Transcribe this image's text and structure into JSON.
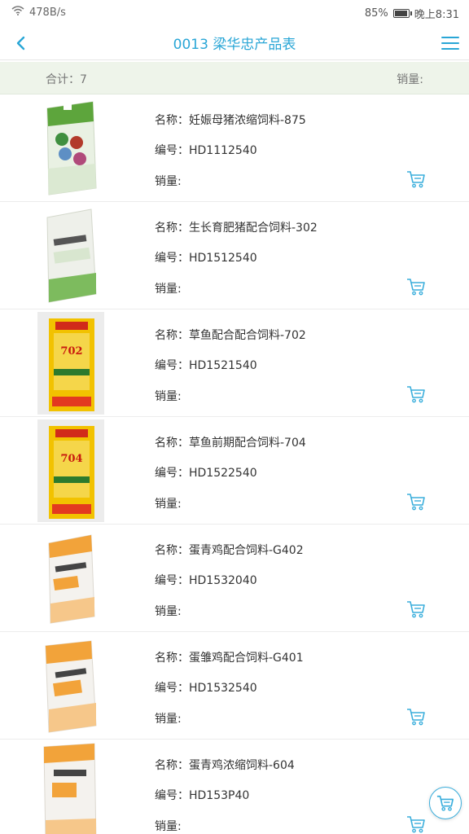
{
  "status_bar": {
    "network_speed": "478B/s",
    "battery": "85%",
    "time": "晚上8:31",
    "battery_level": 0.85
  },
  "header": {
    "title": "0013 梁华忠产品表",
    "back_icon": "chevron-left-icon",
    "menu_icon": "hamburger-menu-icon"
  },
  "summary": {
    "total": "合计：7",
    "sales_label": "销量:"
  },
  "labels": {
    "name": "名称：",
    "code": "编号：",
    "sales": "销量:"
  },
  "accent_color": "#29a6d6",
  "products": [
    {
      "name": "妊娠母猪浓缩饲料-875",
      "code": "HD1112540",
      "bag": "green"
    },
    {
      "name": "生长育肥猪配合饲料-302",
      "code": "HD1512540",
      "bag": "white-green"
    },
    {
      "name": "草鱼配合配合饲料-702",
      "code": "HD1521540",
      "bag": "yellow-red",
      "bag_text": "702"
    },
    {
      "name": "草鱼前期配合饲料-704",
      "code": "HD1522540",
      "bag": "yellow-red",
      "bag_text": "704"
    },
    {
      "name": "蛋青鸡配合饲料-G402",
      "code": "HD1532040",
      "bag": "white-orange"
    },
    {
      "name": "蛋雏鸡配合饲料-G401",
      "code": "HD1532540",
      "bag": "white-orange"
    },
    {
      "name": "蛋青鸡浓缩饲料-604",
      "code": "HD153P40",
      "bag": "white-orange"
    }
  ]
}
